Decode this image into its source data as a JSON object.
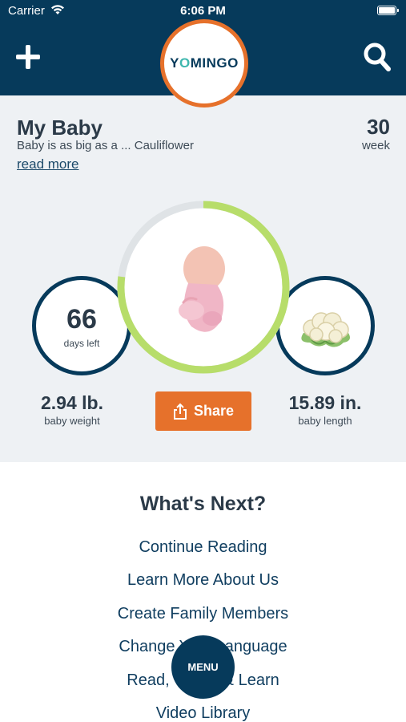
{
  "status_bar": {
    "carrier": "Carrier",
    "time": "6:06 PM"
  },
  "header": {
    "logo_text_pre": "Y",
    "logo_text_o": "O",
    "logo_text_post": "MINGO"
  },
  "baby": {
    "title": "My Baby",
    "subtitle": "Baby is as big as a ... Cauliflower",
    "read_more": "read more",
    "week_number": "30",
    "week_label": "week",
    "days_left_number": "66",
    "days_left_label": "days left",
    "weight_value": "2.94 lb.",
    "weight_label": "baby weight",
    "length_value": "15.89 in.",
    "length_label": "baby length",
    "share_label": "Share",
    "progress_fraction": 0.77
  },
  "whats_next": {
    "title": "What's Next?",
    "links": [
      "Continue Reading",
      "Learn More About Us",
      "Create Family Members",
      "Change Your Language",
      "Read, Watch & Learn",
      "Video Library"
    ]
  },
  "menu": {
    "label": "MENU"
  },
  "colors": {
    "navy": "#063a5b",
    "orange": "#e6712b",
    "progress_green": "#b7dd6a",
    "panel_bg": "#eef1f4"
  },
  "icons": {
    "add": "plus-icon",
    "search": "search-icon",
    "share": "share-icon",
    "wifi": "wifi-icon",
    "battery": "battery-icon"
  }
}
